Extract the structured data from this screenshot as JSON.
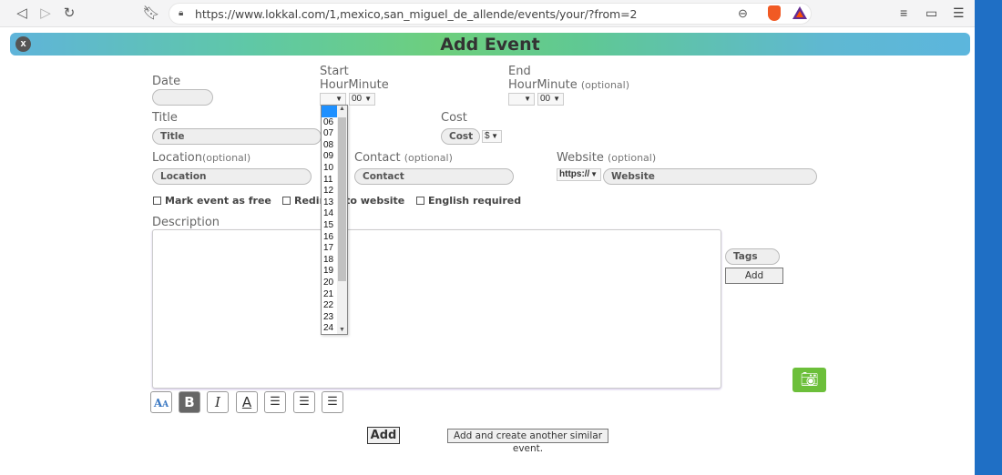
{
  "browser": {
    "url": "https://www.lokkal.com/1,mexico,san_miguel_de_allende/events/your/?from=2"
  },
  "form": {
    "title": "Add Event",
    "close_label": "x",
    "date_label": "Date",
    "start_label_1": "Start",
    "start_label_2": "HourMinute",
    "end_label_1": "End",
    "end_label_2": "HourMinute",
    "end_optional": "(optional)",
    "start_minute": "00",
    "end_minute": "00",
    "title_label": "Title",
    "title_placeholder": "Title",
    "cost_label": "Cost",
    "cost_placeholder": "Cost",
    "currency": "$",
    "location_label": "Location",
    "location_optional": "(optional)",
    "location_placeholder": "Location",
    "contact_label": "Contact",
    "contact_optional": "(optional)",
    "contact_placeholder": "Contact",
    "website_label": "Website",
    "website_optional": "(optional)",
    "protocol": "https://",
    "website_placeholder": "Website",
    "cb_free": "Mark event as free",
    "cb_redirect": "Redirect to website",
    "cb_english": "English required",
    "description_label": "Description",
    "tags_placeholder": "Tags",
    "tags_add": "Add",
    "add_button": "Add",
    "add_another_button": "Add and create another similar event."
  },
  "hour_dropdown": {
    "options": [
      "",
      "06",
      "07",
      "08",
      "09",
      "10",
      "11",
      "12",
      "13",
      "14",
      "15",
      "16",
      "17",
      "18",
      "19",
      "20",
      "21",
      "22",
      "23",
      "24"
    ]
  },
  "colors": {
    "accent_green": "#6cbf3a",
    "selected_blue": "#1e90ff"
  }
}
